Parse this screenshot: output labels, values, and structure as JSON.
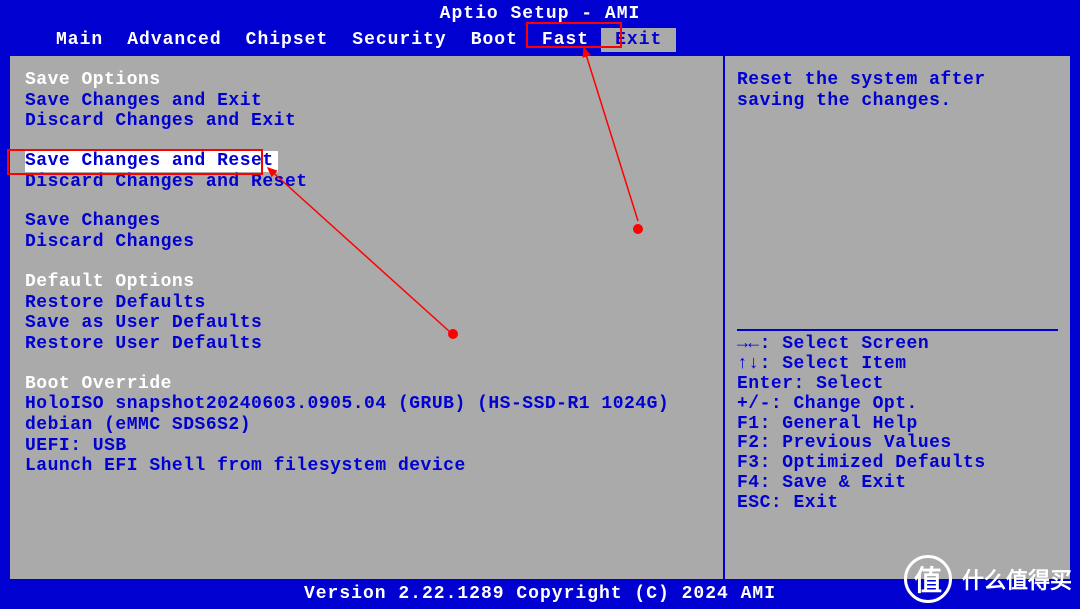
{
  "header": {
    "title": "Aptio Setup - AMI",
    "tabs": [
      "Main",
      "Advanced",
      "Chipset",
      "Security",
      "Boot",
      "Fast",
      "Exit"
    ],
    "active_tab": "Exit"
  },
  "left": {
    "save_options_header": "Save Options",
    "save_changes_exit": "Save Changes and Exit",
    "discard_changes_exit": "Discard Changes and Exit",
    "save_changes_reset": "Save Changes and Reset",
    "discard_changes_reset": "Discard Changes and Reset",
    "save_changes": "Save Changes",
    "discard_changes": "Discard Changes",
    "default_options_header": "Default Options",
    "restore_defaults": "Restore Defaults",
    "save_user_defaults": "Save as User Defaults",
    "restore_user_defaults": "Restore User Defaults",
    "boot_override_header": "Boot Override",
    "boot_holoiso": "HoloISO snapshot20240603.0905.04 (GRUB) (HS-SSD-R1 1024G)",
    "boot_debian": "debian (eMMC SDS6S2)",
    "boot_uefi_usb": "UEFI:  USB",
    "boot_efi_shell": "Launch EFI Shell from filesystem device"
  },
  "right": {
    "help_text": "Reset the system after saving the changes.",
    "nav": [
      "→←: Select Screen",
      "↑↓: Select Item",
      "Enter: Select",
      "+/-: Change Opt.",
      "F1: General Help",
      "F2: Previous Values",
      "F3: Optimized Defaults",
      "F4: Save & Exit",
      "ESC: Exit"
    ]
  },
  "footer": {
    "copyright": "Version 2.22.1289 Copyright (C) 2024 AMI"
  },
  "watermark": {
    "icon": "值",
    "text": "什么值得买"
  },
  "annotations": {
    "dot1": "1",
    "dot2": "2"
  }
}
